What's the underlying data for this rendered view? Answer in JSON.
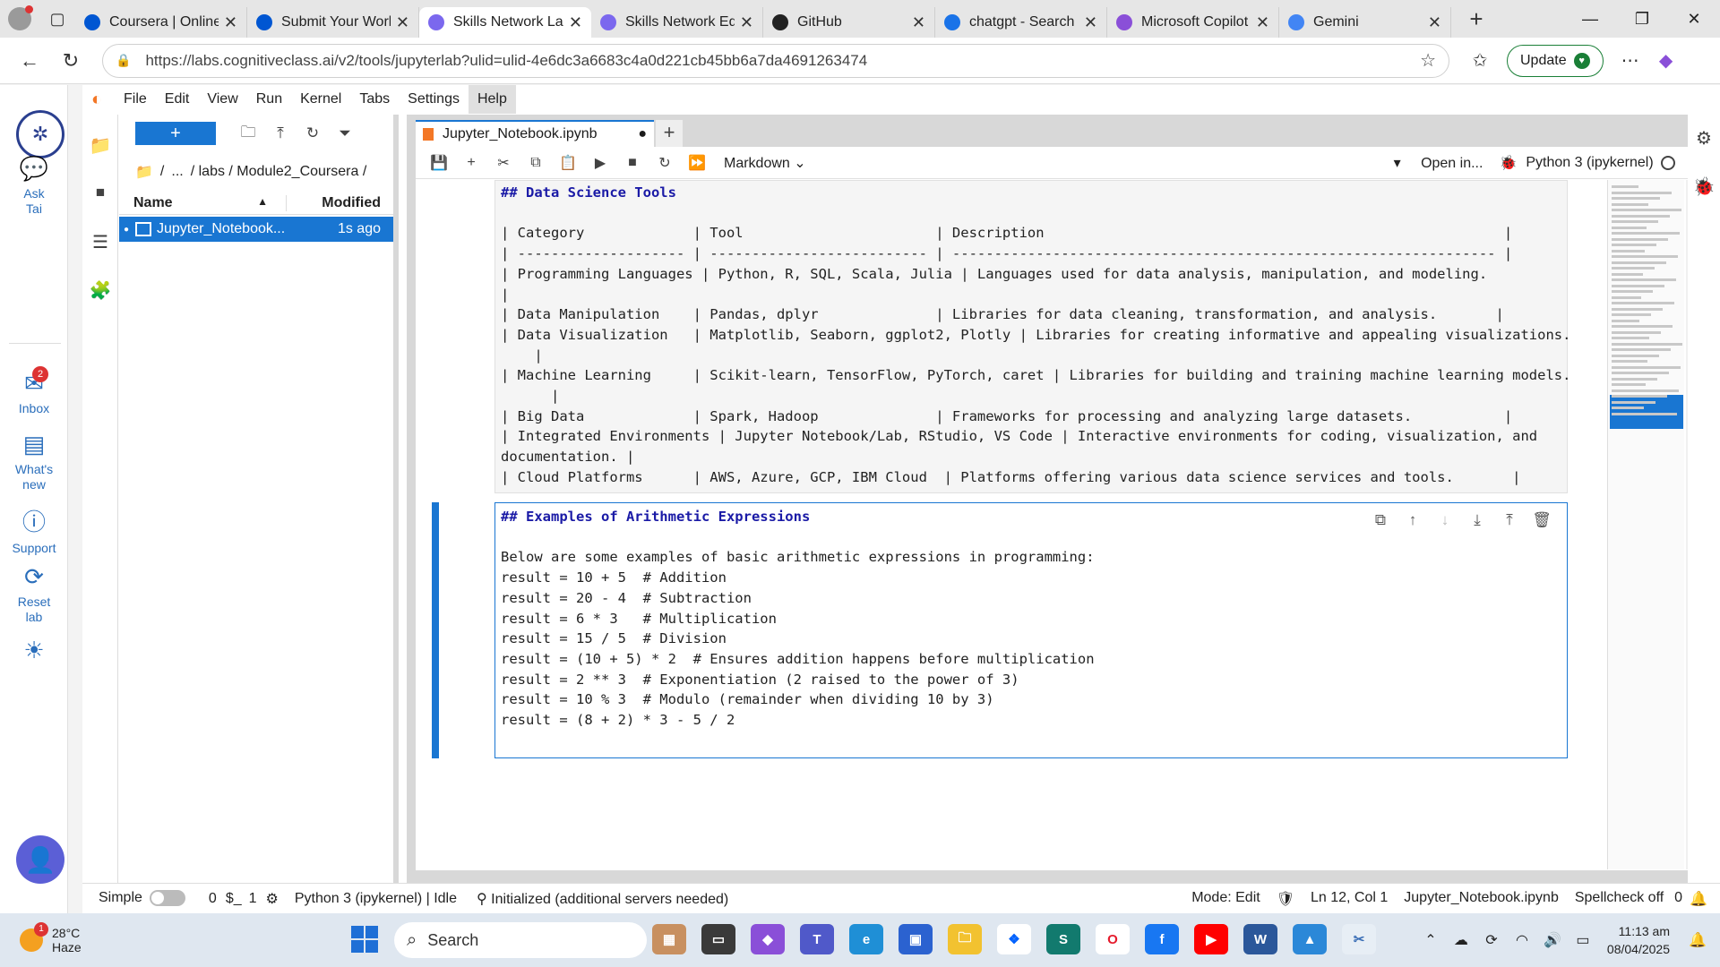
{
  "browser": {
    "tabs": [
      {
        "title": "Coursera | Online",
        "icon": "coursera-icon",
        "color": "#0056d2"
      },
      {
        "title": "Submit Your Worl",
        "icon": "coursera-icon",
        "color": "#0056d2"
      },
      {
        "title": "Skills Network Lal",
        "icon": "skills-network-icon",
        "color": "#7b68ee",
        "active": true
      },
      {
        "title": "Skills Network Ed",
        "icon": "skills-network-icon",
        "color": "#7b68ee"
      },
      {
        "title": "GitHub",
        "icon": "github-icon",
        "color": "#222222"
      },
      {
        "title": "chatgpt - Search",
        "icon": "search-icon",
        "color": "#1a73e8"
      },
      {
        "title": "Microsoft Copilot",
        "icon": "copilot-icon",
        "color": "#8a4fd8"
      },
      {
        "title": "Gemini",
        "icon": "gemini-icon",
        "color": "#4285f4"
      }
    ],
    "url": "https://labs.cognitiveclass.ai/v2/tools/jupyterlab?ulid=ulid-4e6dc3a6683c4a0d221cb45bb6a7da4691263474",
    "update_label": "Update"
  },
  "rail": {
    "ask": "Ask Tai",
    "inbox": "Inbox",
    "inbox_count": "2",
    "whats_new": "What's new",
    "support": "Support",
    "reset": "Reset lab"
  },
  "menu": [
    "File",
    "Edit",
    "View",
    "Run",
    "Kernel",
    "Tabs",
    "Settings",
    "Help"
  ],
  "filebrowser": {
    "breadcrumb": [
      "/",
      "...",
      "/ labs / Module2_Coursera /"
    ],
    "col_name": "Name",
    "col_modified": "Modified",
    "files": [
      {
        "name": "Jupyter_Notebook...",
        "modified": "1s ago"
      }
    ]
  },
  "notebook": {
    "tab_title": "Jupyter_Notebook.ipynb",
    "cell_type": "Markdown",
    "open_in": "Open in...",
    "kernel": "Python 3 (ipykernel)",
    "cell1_lines": [
      "## Data Science Tools",
      "",
      "| Category             | Tool                       | Description                                                       |",
      "| -------------------- | -------------------------- | ----------------------------------------------------------------- |",
      "| Programming Languages | Python, R, SQL, Scala, Julia | Languages used for data analysis, manipulation, and modeling.",
      "|",
      "| Data Manipulation    | Pandas, dplyr              | Libraries for data cleaning, transformation, and analysis.       |",
      "| Data Visualization   | Matplotlib, Seaborn, ggplot2, Plotly | Libraries for creating informative and appealing visualizations.",
      "    |",
      "| Machine Learning     | Scikit-learn, TensorFlow, PyTorch, caret | Libraries for building and training machine learning models.",
      "      |",
      "| Big Data             | Spark, Hadoop              | Frameworks for processing and analyzing large datasets.           |",
      "| Integrated Environments | Jupyter Notebook/Lab, RStudio, VS Code | Interactive environments for coding, visualization, and",
      "documentation. |",
      "| Cloud Platforms      | AWS, Azure, GCP, IBM Cloud  | Platforms offering various data science services and tools.       |"
    ],
    "cell2_lines": [
      "## Examples of Arithmetic Expressions",
      "",
      "Below are some examples of basic arithmetic expressions in programming:",
      "result = 10 + 5  # Addition",
      "result = 20 - 4  # Subtraction",
      "result = 6 * 3   # Multiplication",
      "result = 15 / 5  # Division",
      "result = (10 + 5) * 2  # Ensures addition happens before multiplication",
      "result = 2 ** 3  # Exponentiation (2 raised to the power of 3)",
      "result = 10 % 3  # Modulo (remainder when dividing 10 by 3)",
      "result = (8 + 2) * 3 - 5 / 2"
    ]
  },
  "status": {
    "simple": "Simple",
    "count_a": "0",
    "count_b": "1",
    "kernel_state": "Python 3 (ipykernel) | Idle",
    "init": "Initialized (additional servers needed)",
    "mode": "Mode: Edit",
    "position": "Ln 12, Col 1",
    "file": "Jupyter_Notebook.ipynb",
    "spellcheck": "Spellcheck off",
    "notif": "0"
  },
  "taskbar": {
    "temp": "28°C",
    "weather": "Haze",
    "weather_badge": "1",
    "search": "Search",
    "time": "11:13 am",
    "date": "08/04/2025"
  }
}
